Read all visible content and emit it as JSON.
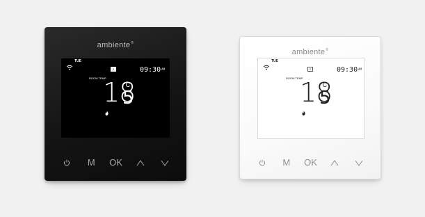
{
  "devices": [
    {
      "variant": "black",
      "brand": "ambiente",
      "brand_mark": "®",
      "screen": {
        "day": "TUE",
        "program_badge": "2",
        "time": "09:30",
        "ampm": "AM",
        "room_temp_label": "ROOM TEMP",
        "temp_whole": "18",
        "temp_decimal": "5",
        "temp_unit": "°C",
        "icons": [
          "wifi-icon",
          "flame-icon"
        ]
      },
      "buttons": {
        "power": "power-icon",
        "mode": "M",
        "ok": "OK",
        "up": "chevron-up-icon",
        "down": "chevron-down-icon"
      }
    },
    {
      "variant": "white",
      "brand": "ambiente",
      "brand_mark": "®",
      "screen": {
        "day": "TUE",
        "program_badge": "2",
        "time": "09:30",
        "ampm": "AM",
        "room_temp_label": "ROOM TEMP",
        "temp_whole": "18",
        "temp_decimal": "5",
        "temp_unit": "°C",
        "icons": [
          "wifi-icon",
          "flame-icon"
        ]
      },
      "buttons": {
        "power": "power-icon",
        "mode": "M",
        "ok": "OK",
        "up": "chevron-up-icon",
        "down": "chevron-down-icon"
      }
    }
  ],
  "colors": {
    "background": "#f1f1f1",
    "black_unit": "#141414",
    "white_unit": "#fafafa"
  }
}
